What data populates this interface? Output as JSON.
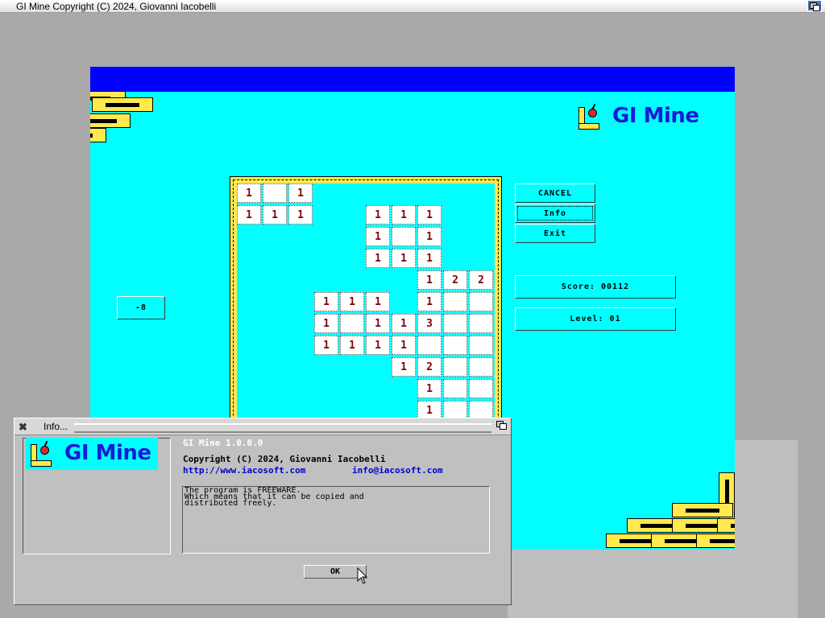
{
  "screen": {
    "title": "GI Mine Copyright (C) 2024, Giovanni Iacobelli"
  },
  "game": {
    "logo_text": "GI Mine",
    "buttons": {
      "cancel": "CANCEL",
      "info": "Info",
      "exit": "Exit"
    },
    "counter": "-8",
    "score": "Score: 00112",
    "level": "Level: 01",
    "cells": [
      {
        "r": 0,
        "c": 0,
        "v": "1"
      },
      {
        "r": 0,
        "c": 1,
        "v": ""
      },
      {
        "r": 0,
        "c": 2,
        "v": "1"
      },
      {
        "r": 1,
        "c": 0,
        "v": "1"
      },
      {
        "r": 1,
        "c": 1,
        "v": "1"
      },
      {
        "r": 1,
        "c": 2,
        "v": "1"
      },
      {
        "r": 1,
        "c": 5,
        "v": "1"
      },
      {
        "r": 1,
        "c": 6,
        "v": "1"
      },
      {
        "r": 1,
        "c": 7,
        "v": "1"
      },
      {
        "r": 2,
        "c": 5,
        "v": "1"
      },
      {
        "r": 2,
        "c": 6,
        "v": ""
      },
      {
        "r": 2,
        "c": 7,
        "v": "1"
      },
      {
        "r": 3,
        "c": 5,
        "v": "1"
      },
      {
        "r": 3,
        "c": 6,
        "v": "1"
      },
      {
        "r": 3,
        "c": 7,
        "v": "1"
      },
      {
        "r": 4,
        "c": 7,
        "v": "1"
      },
      {
        "r": 4,
        "c": 8,
        "v": "2"
      },
      {
        "r": 4,
        "c": 9,
        "v": "2"
      },
      {
        "r": 5,
        "c": 3,
        "v": "1"
      },
      {
        "r": 5,
        "c": 4,
        "v": "1"
      },
      {
        "r": 5,
        "c": 5,
        "v": "1"
      },
      {
        "r": 5,
        "c": 7,
        "v": "1"
      },
      {
        "r": 5,
        "c": 8,
        "v": ""
      },
      {
        "r": 5,
        "c": 9,
        "v": ""
      },
      {
        "r": 6,
        "c": 3,
        "v": "1"
      },
      {
        "r": 6,
        "c": 4,
        "v": ""
      },
      {
        "r": 6,
        "c": 5,
        "v": "1"
      },
      {
        "r": 6,
        "c": 6,
        "v": "1"
      },
      {
        "r": 6,
        "c": 7,
        "v": "3"
      },
      {
        "r": 6,
        "c": 8,
        "v": ""
      },
      {
        "r": 6,
        "c": 9,
        "v": ""
      },
      {
        "r": 7,
        "c": 3,
        "v": "1"
      },
      {
        "r": 7,
        "c": 4,
        "v": "1"
      },
      {
        "r": 7,
        "c": 5,
        "v": "1"
      },
      {
        "r": 7,
        "c": 6,
        "v": "1"
      },
      {
        "r": 7,
        "c": 7,
        "v": ""
      },
      {
        "r": 7,
        "c": 8,
        "v": ""
      },
      {
        "r": 7,
        "c": 9,
        "v": ""
      },
      {
        "r": 8,
        "c": 6,
        "v": "1"
      },
      {
        "r": 8,
        "c": 7,
        "v": "2"
      },
      {
        "r": 8,
        "c": 8,
        "v": ""
      },
      {
        "r": 8,
        "c": 9,
        "v": ""
      },
      {
        "r": 9,
        "c": 7,
        "v": "1"
      },
      {
        "r": 9,
        "c": 8,
        "v": ""
      },
      {
        "r": 9,
        "c": 9,
        "v": ""
      },
      {
        "r": 10,
        "c": 7,
        "v": "1"
      },
      {
        "r": 10,
        "c": 8,
        "v": ""
      },
      {
        "r": 10,
        "c": 9,
        "v": ""
      }
    ],
    "colors": {
      "background": "#00ffff",
      "header": "#0000ff",
      "brick": "#ffe94d",
      "number": "#800000"
    }
  },
  "info": {
    "title": "Info...",
    "logo_text": "GI Mine",
    "version": "GI Mine 1.0.0.0",
    "copyright": "Copyright (C) 2024, Giovanni Iacobelli",
    "website": "http://www.iacosoft.com",
    "email": "info@iacosoft.com",
    "message": "The program is FREEWARE.\nWhich means that it can be copied and\ndistributed freely.",
    "ok": "OK"
  }
}
